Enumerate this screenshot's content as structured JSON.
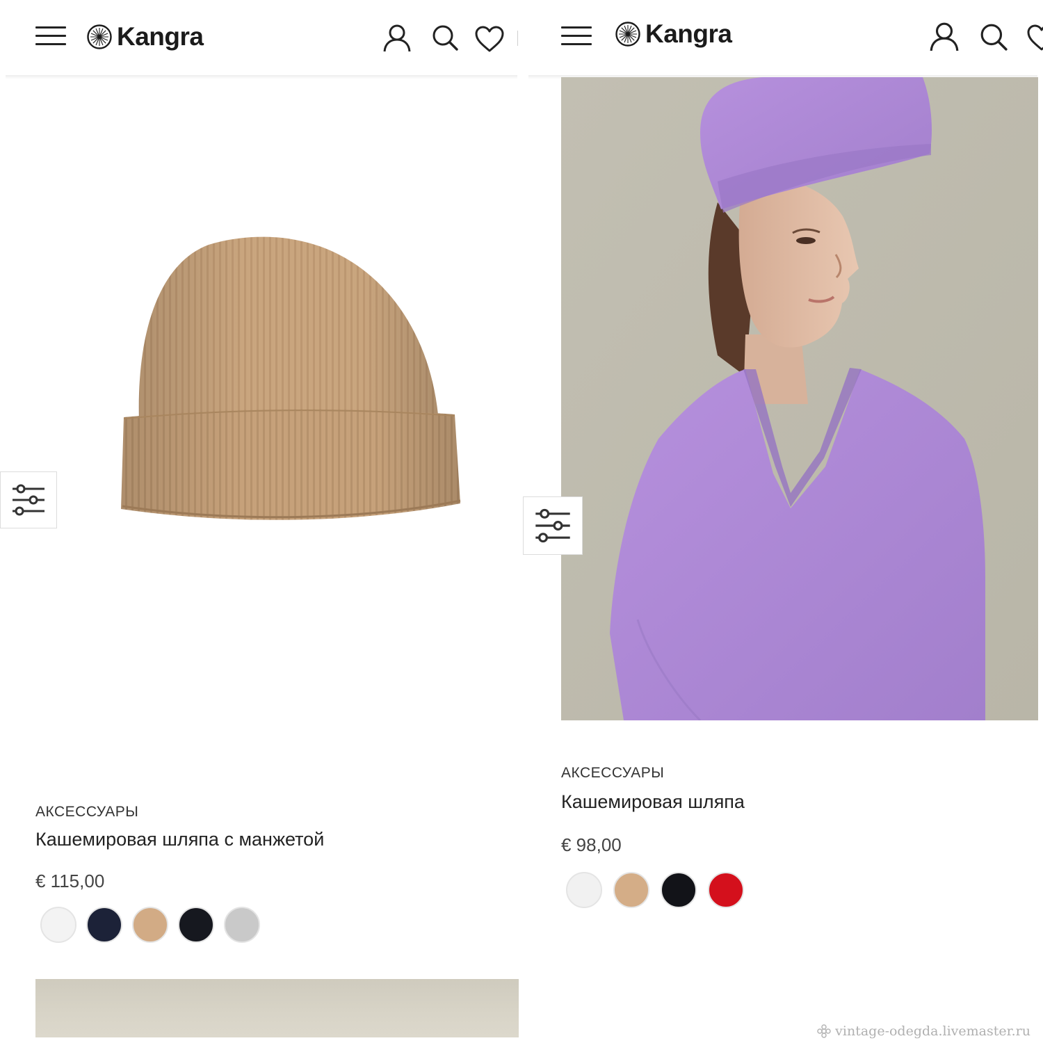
{
  "left_screen": {
    "header": {
      "logo_text": "Kangra",
      "menu_icon": "hamburger-icon",
      "icons": [
        "user-icon",
        "search-icon",
        "heart-icon"
      ]
    },
    "product": {
      "category": "АКСЕССУАРЫ",
      "name": "Кашемировая шляпа с манжетой",
      "price": "€ 115,00",
      "image_icon": "beanie-hat-image",
      "colors": [
        "#f3f3f3",
        "#1c2238",
        "#d2ab85",
        "#16181f",
        "#c9c9c9"
      ]
    },
    "filter_icon": "filter-sliders-icon"
  },
  "right_screen": {
    "header": {
      "logo_text": "Kangra",
      "menu_icon": "hamburger-icon",
      "icons": [
        "user-icon",
        "search-icon",
        "heart-icon"
      ]
    },
    "product": {
      "category": "АКСЕССУАРЫ",
      "name": "Кашемировая шляпа",
      "price": "€ 98,00",
      "image_icon": "model-lilac-hat-photo",
      "colors": [
        "#f1f1f1",
        "#d4ad87",
        "#121318",
        "#d4101c"
      ]
    },
    "filter_icon": "filter-sliders-icon"
  },
  "watermark": {
    "text": "vintage-odegda.livemaster.ru",
    "icon": "flower-icon"
  }
}
